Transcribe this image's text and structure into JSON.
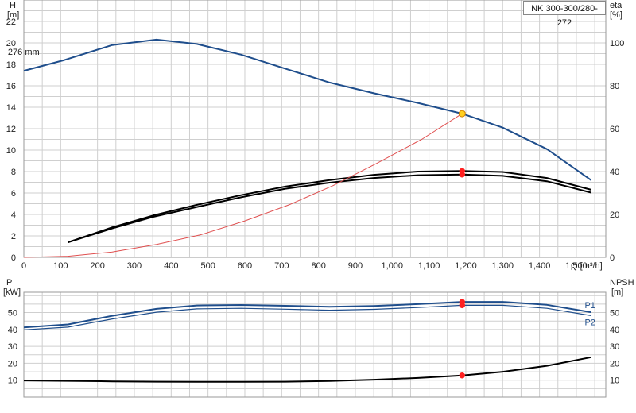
{
  "model_label": "NK 300-300/280-272",
  "colors": {
    "head": "#1f4e8c",
    "efficiency": "#000000",
    "system": "#e05050",
    "power": "#1f4e8c",
    "npsh": "#000000",
    "duty_point": "#ff2020",
    "intersection": "#ffd020"
  },
  "chart_data": [
    {
      "type": "line",
      "x_axis": {
        "label": "Q [m³/h]",
        "ticks": [
          "0",
          "100",
          "200",
          "300",
          "400",
          "500",
          "600",
          "700",
          "800",
          "900",
          "1,000",
          "1,100",
          "1,200",
          "1,300",
          "1,400",
          "1,500"
        ],
        "range": [
          0,
          1580
        ]
      },
      "y_left": {
        "label_top": "H",
        "label_unit": "[m]",
        "range": [
          0,
          24
        ],
        "ticks": [
          "0",
          "2",
          "4",
          "6",
          "8",
          "10",
          "12",
          "14",
          "16",
          "18",
          "20",
          "22"
        ]
      },
      "y_right": {
        "label_top": "eta",
        "label_unit": "[%]",
        "range": [
          0,
          120
        ],
        "ticks": [
          "0",
          "20",
          "40",
          "60",
          "80",
          "100"
        ]
      },
      "annotations": [
        {
          "text": "276 mm",
          "x": 125,
          "y": 19.2
        }
      ],
      "series": [
        {
          "key": "head",
          "axis": "left",
          "x": [
            0,
            110,
            240,
            360,
            470,
            590,
            710,
            830,
            950,
            1070,
            1190,
            1300,
            1420,
            1540
          ],
          "y": [
            17.4,
            18.4,
            19.8,
            20.3,
            19.9,
            18.9,
            17.6,
            16.3,
            15.3,
            14.4,
            13.4,
            12.1,
            10.1,
            7.2
          ]
        },
        {
          "key": "eta_1",
          "axis": "right",
          "x": [
            120,
            240,
            350,
            470,
            590,
            710,
            830,
            950,
            1070,
            1190,
            1300,
            1420,
            1540
          ],
          "y": [
            7,
            14,
            19.5,
            24.5,
            29,
            33,
            36,
            38.5,
            40,
            40.3,
            39.8,
            37,
            31.5
          ]
        },
        {
          "key": "eta_2",
          "axis": "right",
          "x": [
            120,
            240,
            350,
            470,
            590,
            710,
            830,
            950,
            1070,
            1190,
            1300,
            1420,
            1540
          ],
          "y": [
            7,
            13.5,
            18.8,
            23.5,
            28,
            32,
            34.8,
            37,
            38.3,
            38.6,
            38,
            35.5,
            30.2
          ]
        },
        {
          "key": "system",
          "axis": "left",
          "x": [
            0,
            120,
            240,
            360,
            480,
            600,
            720,
            840,
            960,
            1080,
            1190
          ],
          "y": [
            0,
            0.1,
            0.5,
            1.2,
            2.1,
            3.4,
            4.9,
            6.7,
            8.8,
            11,
            13.4
          ]
        }
      ],
      "duty_points": [
        {
          "x": 1190,
          "y": 13.4,
          "kind": "intersection"
        },
        {
          "x": 1190,
          "y": 40.3,
          "kind": "duty",
          "axis": "right"
        },
        {
          "x": 1190,
          "y": 38.6,
          "kind": "duty",
          "axis": "right"
        }
      ]
    },
    {
      "type": "line",
      "y_left": {
        "label_top": "P",
        "label_unit": "[kW]",
        "range": [
          0,
          62
        ],
        "ticks": [
          "10",
          "20",
          "30",
          "40",
          "50"
        ]
      },
      "y_right": {
        "label_top": "NPSH",
        "label_unit": "[m]",
        "range": [
          0,
          62
        ],
        "ticks": [
          "10",
          "20",
          "30",
          "40",
          "50"
        ]
      },
      "series": [
        {
          "key": "P1",
          "name": "P1",
          "axis": "left",
          "x": [
            0,
            120,
            240,
            360,
            470,
            590,
            710,
            830,
            950,
            1070,
            1190,
            1300,
            1420,
            1540
          ],
          "y": [
            41.2,
            43,
            48.1,
            52.2,
            54.2,
            54.5,
            54,
            53.4,
            53.9,
            55,
            56.3,
            56.3,
            54.6,
            50.2
          ]
        },
        {
          "key": "P2",
          "name": "P2",
          "axis": "left",
          "x": [
            0,
            120,
            240,
            360,
            470,
            590,
            710,
            830,
            950,
            1070,
            1190,
            1300,
            1420,
            1540
          ],
          "y": [
            39.8,
            41.4,
            46.2,
            50.2,
            52.2,
            52.5,
            52,
            51.4,
            51.9,
            53,
            54.3,
            54.3,
            52.5,
            48.2
          ]
        },
        {
          "key": "npsh",
          "axis": "right",
          "x": [
            0,
            120,
            240,
            360,
            470,
            590,
            710,
            830,
            950,
            1070,
            1190,
            1300,
            1420,
            1540
          ],
          "y": [
            9.8,
            9.6,
            9.3,
            9.1,
            9,
            9,
            9.1,
            9.5,
            10.3,
            11.3,
            12.8,
            15,
            18.5,
            23.6
          ]
        }
      ],
      "duty_points": [
        {
          "x": 1190,
          "y": 56.3,
          "kind": "duty"
        },
        {
          "x": 1190,
          "y": 54.3,
          "kind": "duty"
        },
        {
          "x": 1190,
          "y": 12.8,
          "kind": "duty",
          "axis": "right"
        }
      ]
    }
  ]
}
